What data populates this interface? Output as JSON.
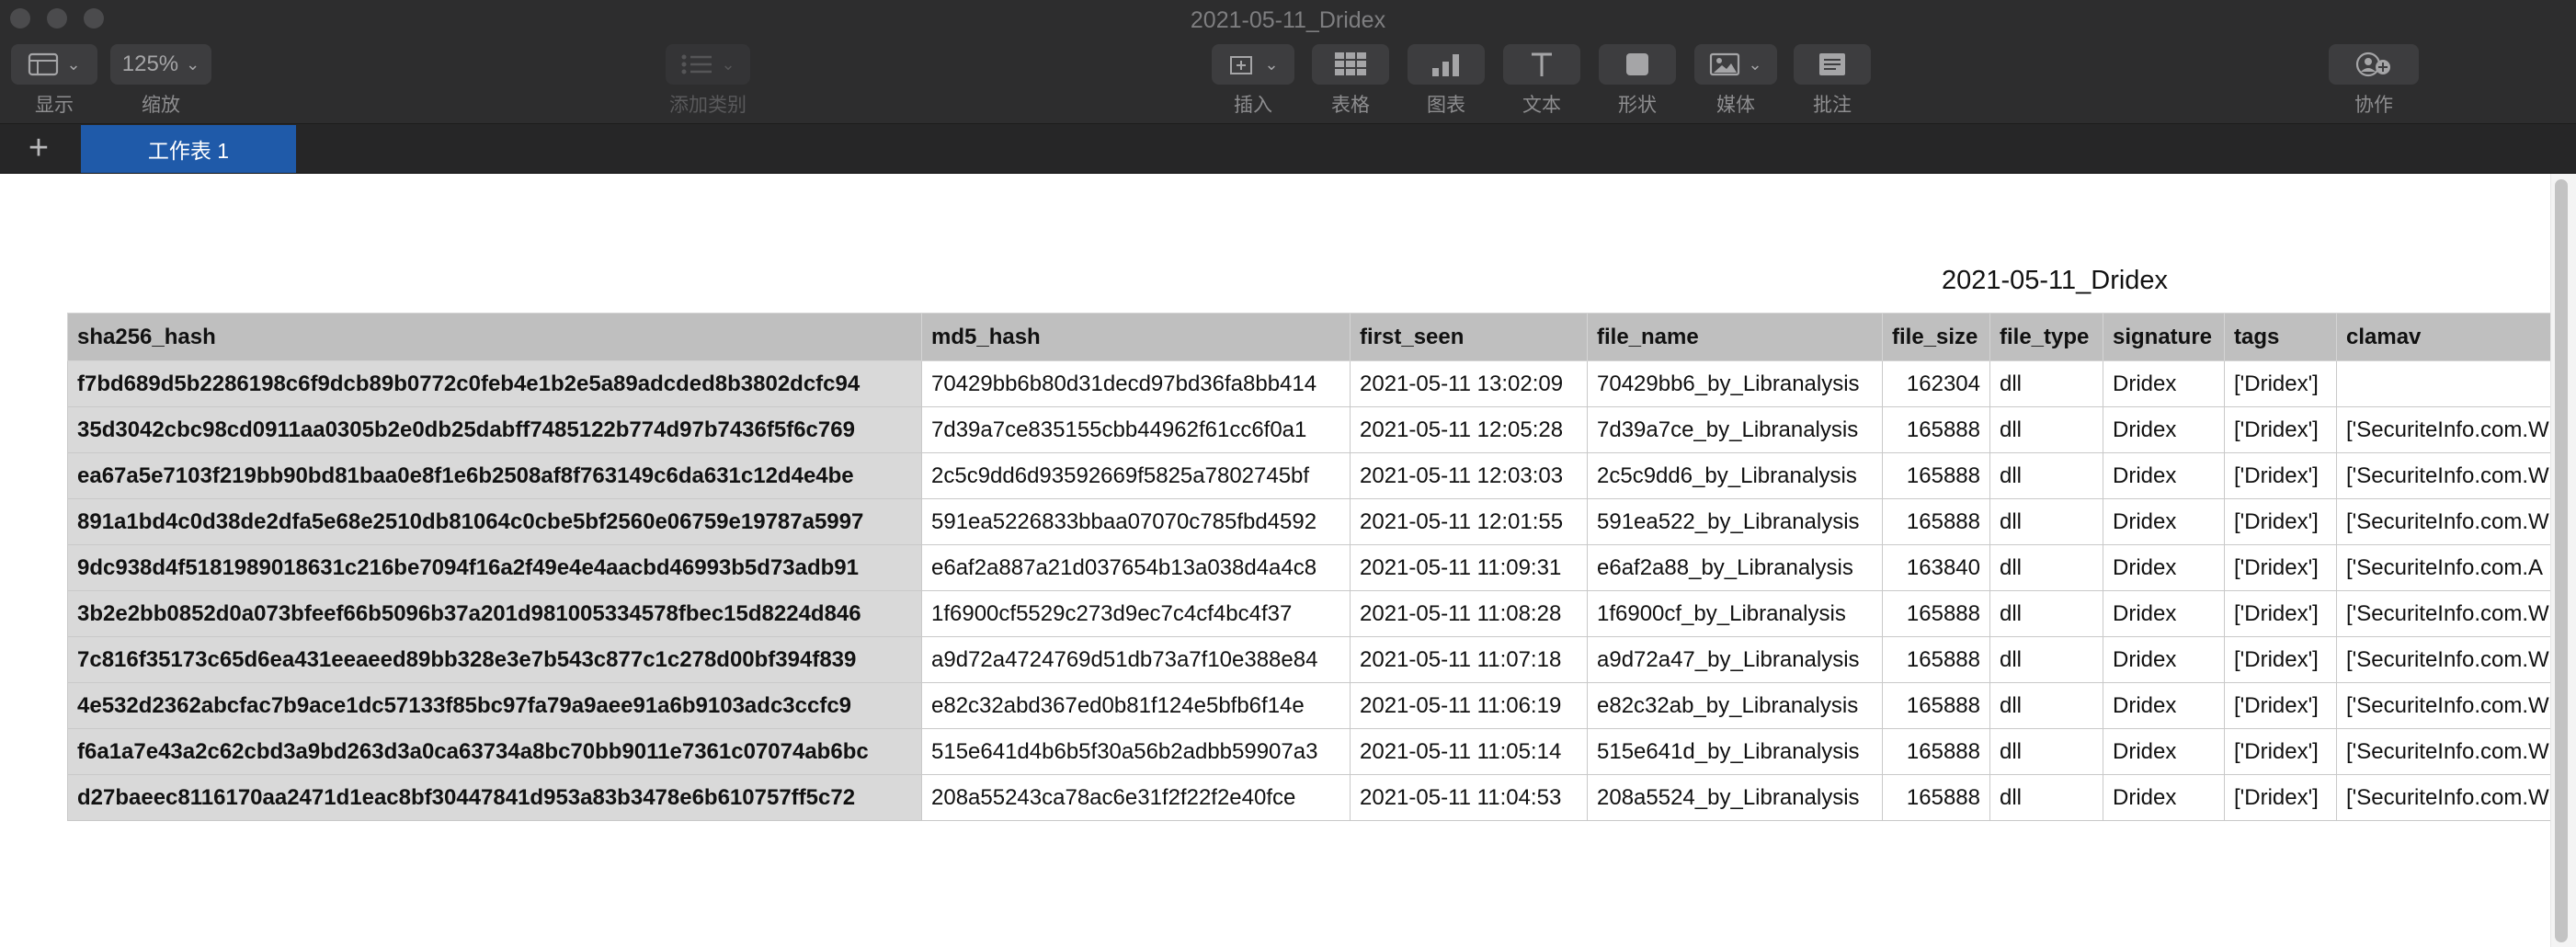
{
  "window": {
    "title": "2021-05-11_Dridex"
  },
  "toolbar": {
    "view_label": "显示",
    "zoom_value": "125%",
    "zoom_label": "缩放",
    "add_category_label": "添加类别",
    "insert_label": "插入",
    "table_label": "表格",
    "chart_label": "图表",
    "text_label": "文本",
    "shape_label": "形状",
    "media_label": "媒体",
    "comment_label": "批注",
    "collaborate_label": "协作"
  },
  "tabs": {
    "add_symbol": "+",
    "active_sheet": "工作表 1"
  },
  "table": {
    "title": "2021-05-11_Dridex",
    "columns": [
      "sha256_hash",
      "md5_hash",
      "first_seen",
      "file_name",
      "file_size",
      "file_type",
      "signature",
      "tags",
      "clamav"
    ],
    "rows": [
      [
        "f7bd689d5b2286198c6f9dcb89b0772c0feb4e1b2e5a89adcded8b3802dcfc94",
        "70429bb6b80d31decd97bd36fa8bb414",
        "2021-05-11 13:02:09",
        "70429bb6_by_Libranalysis",
        "162304",
        "dll",
        "Dridex",
        "['Dridex']",
        ""
      ],
      [
        "35d3042cbc98cd0911aa0305b2e0db25dabff7485122b774d97b7436f5f6c769",
        "7d39a7ce835155cbb44962f61cc6f0a1",
        "2021-05-11 12:05:28",
        "7d39a7ce_by_Libranalysis",
        "165888",
        "dll",
        "Dridex",
        "['Dridex']",
        "['SecuriteInfo.com.W"
      ],
      [
        "ea67a5e7103f219bb90bd81baa0e8f1e6b2508af8f763149c6da631c12d4e4be",
        "2c5c9dd6d93592669f5825a7802745bf",
        "2021-05-11 12:03:03",
        "2c5c9dd6_by_Libranalysis",
        "165888",
        "dll",
        "Dridex",
        "['Dridex']",
        "['SecuriteInfo.com.W"
      ],
      [
        "891a1bd4c0d38de2dfa5e68e2510db81064c0cbe5bf2560e06759e19787a5997",
        "591ea5226833bbaa07070c785fbd4592",
        "2021-05-11 12:01:55",
        "591ea522_by_Libranalysis",
        "165888",
        "dll",
        "Dridex",
        "['Dridex']",
        "['SecuriteInfo.com.W"
      ],
      [
        "9dc938d4f5181989018631c216be7094f16a2f49e4e4aacbd46993b5d73adb91",
        "e6af2a887a21d037654b13a038d4a4c8",
        "2021-05-11 11:09:31",
        "e6af2a88_by_Libranalysis",
        "163840",
        "dll",
        "Dridex",
        "['Dridex']",
        "['SecuriteInfo.com.A"
      ],
      [
        "3b2e2bb0852d0a073bfeef66b5096b37a201d981005334578fbec15d8224d846",
        "1f6900cf5529c273d9ec7c4cf4bc4f37",
        "2021-05-11 11:08:28",
        "1f6900cf_by_Libranalysis",
        "165888",
        "dll",
        "Dridex",
        "['Dridex']",
        "['SecuriteInfo.com.W"
      ],
      [
        "7c816f35173c65d6ea431eeaeed89bb328e3e7b543c877c1c278d00bf394f839",
        "a9d72a4724769d51db73a7f10e388e84",
        "2021-05-11 11:07:18",
        "a9d72a47_by_Libranalysis",
        "165888",
        "dll",
        "Dridex",
        "['Dridex']",
        "['SecuriteInfo.com.W"
      ],
      [
        "4e532d2362abcfac7b9ace1dc57133f85bc97fa79a9aee91a6b9103adc3ccfc9",
        "e82c32abd367ed0b81f124e5bfb6f14e",
        "2021-05-11 11:06:19",
        "e82c32ab_by_Libranalysis",
        "165888",
        "dll",
        "Dridex",
        "['Dridex']",
        "['SecuriteInfo.com.W"
      ],
      [
        "f6a1a7e43a2c62cbd3a9bd263d3a0ca63734a8bc70bb9011e7361c07074ab6bc",
        "515e641d4b6b5f30a56b2adbb59907a3",
        "2021-05-11 11:05:14",
        "515e641d_by_Libranalysis",
        "165888",
        "dll",
        "Dridex",
        "['Dridex']",
        "['SecuriteInfo.com.W"
      ],
      [
        "d27baeec8116170aa2471d1eac8bf30447841d953a83b3478e6b610757ff5c72",
        "208a55243ca78ac6e31f2f22f2e40fce",
        "2021-05-11 11:04:53",
        "208a5524_by_Libranalysis",
        "165888",
        "dll",
        "Dridex",
        "['Dridex']",
        "['SecuriteInfo.com.W"
      ]
    ]
  },
  "colors": {
    "toolbar_bg": "#2d2d2e",
    "active_tab": "#1f5aa9",
    "header_row_bg": "#bfbfbf",
    "row_header_bg": "#d9d9d9"
  },
  "icons": [
    "view-icon",
    "zoom-chevron-icon",
    "add-category-icon",
    "insert-icon",
    "table-icon",
    "chart-icon",
    "text-icon",
    "shape-icon",
    "media-icon",
    "comment-icon",
    "collaborate-icon"
  ]
}
